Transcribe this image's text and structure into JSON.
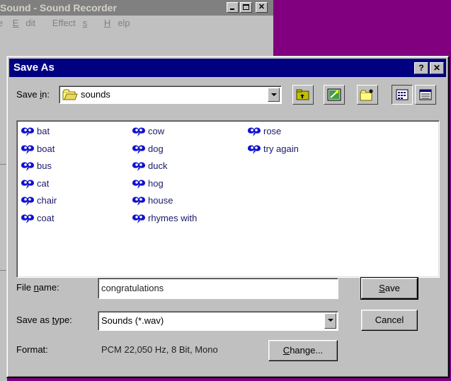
{
  "background_window": {
    "title": "Sound - Sound Recorder",
    "menu": [
      {
        "label": "le"
      },
      {
        "label": "Edit",
        "accel": "E",
        "rest": "dit"
      },
      {
        "label": "Effects",
        "accel_pre": "Effect",
        "accel": "s"
      },
      {
        "label": "Help",
        "accel": "H",
        "rest": "elp"
      }
    ]
  },
  "dialog": {
    "title": "Save As",
    "help_glyph": "?",
    "close_glyph": "✕",
    "save_in": {
      "label_pre": "Save ",
      "label_accel": "i",
      "label_post": "n:",
      "value": "sounds"
    },
    "files": [
      {
        "name": "bat"
      },
      {
        "name": "boat"
      },
      {
        "name": "bus"
      },
      {
        "name": "cat"
      },
      {
        "name": "chair"
      },
      {
        "name": "coat"
      },
      {
        "name": "cow"
      },
      {
        "name": "dog"
      },
      {
        "name": "duck"
      },
      {
        "name": "hog"
      },
      {
        "name": "house"
      },
      {
        "name": "rhymes with"
      },
      {
        "name": "rose"
      },
      {
        "name": "try again"
      }
    ],
    "file_name": {
      "label_pre": "File ",
      "label_accel": "n",
      "label_post": "ame:",
      "value": "congratulations"
    },
    "save_as_type": {
      "label_pre": "Save as ",
      "label_accel": "t",
      "label_post": "ype:",
      "value": "Sounds (*.wav)"
    },
    "format": {
      "label": "Format:",
      "value": "PCM 22,050 Hz, 8 Bit, Mono"
    },
    "buttons": {
      "save_accel": "S",
      "save_rest": "ave",
      "cancel": "Cancel",
      "change_accel": "C",
      "change_rest": "hange..."
    }
  },
  "colors": {
    "desktop": "#800080",
    "title_active": "#000080",
    "title_inactive": "#808080",
    "face": "#c0c0c0",
    "sound_icon": "#1010d0"
  }
}
